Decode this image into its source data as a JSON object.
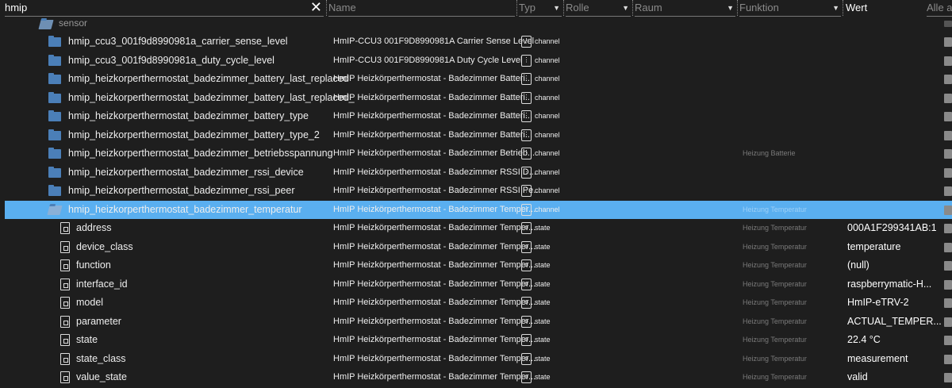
{
  "header": {
    "search_value": "hmip",
    "clear_icon": "close-icon",
    "columns": {
      "name": "Name",
      "typ": "Typ",
      "rolle": "Rolle",
      "raum": "Raum",
      "funktion": "Funktion",
      "wert": "Wert",
      "actions": "Alle a"
    }
  },
  "group": {
    "label": "sensor"
  },
  "rows": [
    {
      "kind": "folder",
      "id": "hmip_ccu3_001f9d8990981a_carrier_sense_level",
      "name": "HmIP-CCU3 001F9D8990981A Carrier Sense Level",
      "typ": "channel",
      "funktion": "",
      "wert": ""
    },
    {
      "kind": "folder",
      "id": "hmip_ccu3_001f9d8990981a_duty_cycle_level",
      "name": "HmIP-CCU3 001F9D8990981A Duty Cycle Level",
      "typ": "channel",
      "funktion": "",
      "wert": ""
    },
    {
      "kind": "folder",
      "id": "hmip_heizkorperthermostat_badezimmer_battery_last_replaced",
      "name": "HmIP Heizkörperthermostat - Badezimmer Batteri...",
      "typ": "channel",
      "funktion": "",
      "wert": ""
    },
    {
      "kind": "folder",
      "id": "hmip_heizkorperthermostat_badezimmer_battery_last_replaced_",
      "name": "HmIP Heizkörperthermostat - Badezimmer Batteri...",
      "typ": "channel",
      "funktion": "",
      "wert": ""
    },
    {
      "kind": "folder",
      "id": "hmip_heizkorperthermostat_badezimmer_battery_type",
      "name": "HmIP Heizkörperthermostat - Badezimmer Batteri...",
      "typ": "channel",
      "funktion": "",
      "wert": ""
    },
    {
      "kind": "folder",
      "id": "hmip_heizkorperthermostat_badezimmer_battery_type_2",
      "name": "HmIP Heizkörperthermostat - Badezimmer Batteri...",
      "typ": "channel",
      "funktion": "",
      "wert": ""
    },
    {
      "kind": "folder",
      "id": "hmip_heizkorperthermostat_badezimmer_betriebsspannung",
      "name": "HmIP Heizkörperthermostat - Badezimmer Betrieb...",
      "typ": "channel",
      "funktion": "Heizung Batterie",
      "wert": ""
    },
    {
      "kind": "folder",
      "id": "hmip_heizkorperthermostat_badezimmer_rssi_device",
      "name": "HmIP Heizkörperthermostat - Badezimmer RSSI D...",
      "typ": "channel",
      "funktion": "",
      "wert": ""
    },
    {
      "kind": "folder",
      "id": "hmip_heizkorperthermostat_badezimmer_rssi_peer",
      "name": "HmIP Heizkörperthermostat - Badezimmer RSSI Pe...",
      "typ": "channel",
      "funktion": "",
      "wert": ""
    },
    {
      "kind": "open",
      "selected": true,
      "id": "hmip_heizkorperthermostat_badezimmer_temperatur",
      "name": "HmIP Heizkörperthermostat - Badezimmer Temper...",
      "typ": "channel",
      "funktion": "Heizung Temperatur",
      "wert": ""
    },
    {
      "kind": "state",
      "id": "address",
      "name": "HmIP Heizkörperthermostat - Badezimmer Temper...",
      "typ": "state",
      "funktion": "Heizung Temperatur",
      "wert": "000A1F299341AB:1"
    },
    {
      "kind": "state",
      "id": "device_class",
      "name": "HmIP Heizkörperthermostat - Badezimmer Temper...",
      "typ": "state",
      "funktion": "Heizung Temperatur",
      "wert": "temperature"
    },
    {
      "kind": "state",
      "id": "function",
      "name": "HmIP Heizkörperthermostat - Badezimmer Temper...",
      "typ": "state",
      "funktion": "Heizung Temperatur",
      "wert": "(null)"
    },
    {
      "kind": "state",
      "id": "interface_id",
      "name": "HmIP Heizkörperthermostat - Badezimmer Temper...",
      "typ": "state",
      "funktion": "Heizung Temperatur",
      "wert": "raspberrymatic-H..."
    },
    {
      "kind": "state",
      "id": "model",
      "name": "HmIP Heizkörperthermostat - Badezimmer Temper...",
      "typ": "state",
      "funktion": "Heizung Temperatur",
      "wert": "HmIP-eTRV-2"
    },
    {
      "kind": "state",
      "id": "parameter",
      "name": "HmIP Heizkörperthermostat - Badezimmer Temper...",
      "typ": "state",
      "funktion": "Heizung Temperatur",
      "wert": "ACTUAL_TEMPER..."
    },
    {
      "kind": "state",
      "id": "state",
      "name": "HmIP Heizkörperthermostat - Badezimmer Temper...",
      "typ": "state",
      "funktion": "Heizung Temperatur",
      "wert": "22.4 °C"
    },
    {
      "kind": "state",
      "id": "state_class",
      "name": "HmIP Heizkörperthermostat - Badezimmer Temper...",
      "typ": "state",
      "funktion": "Heizung Temperatur",
      "wert": "measurement"
    },
    {
      "kind": "state",
      "id": "value_state",
      "name": "HmIP Heizkörperthermostat - Badezimmer Temper...",
      "typ": "state",
      "funktion": "Heizung Temperatur",
      "wert": "valid"
    }
  ],
  "colors": {
    "background": "#1e1e1e",
    "selected": "#5aaff0",
    "folder": "#4b7fb8"
  }
}
